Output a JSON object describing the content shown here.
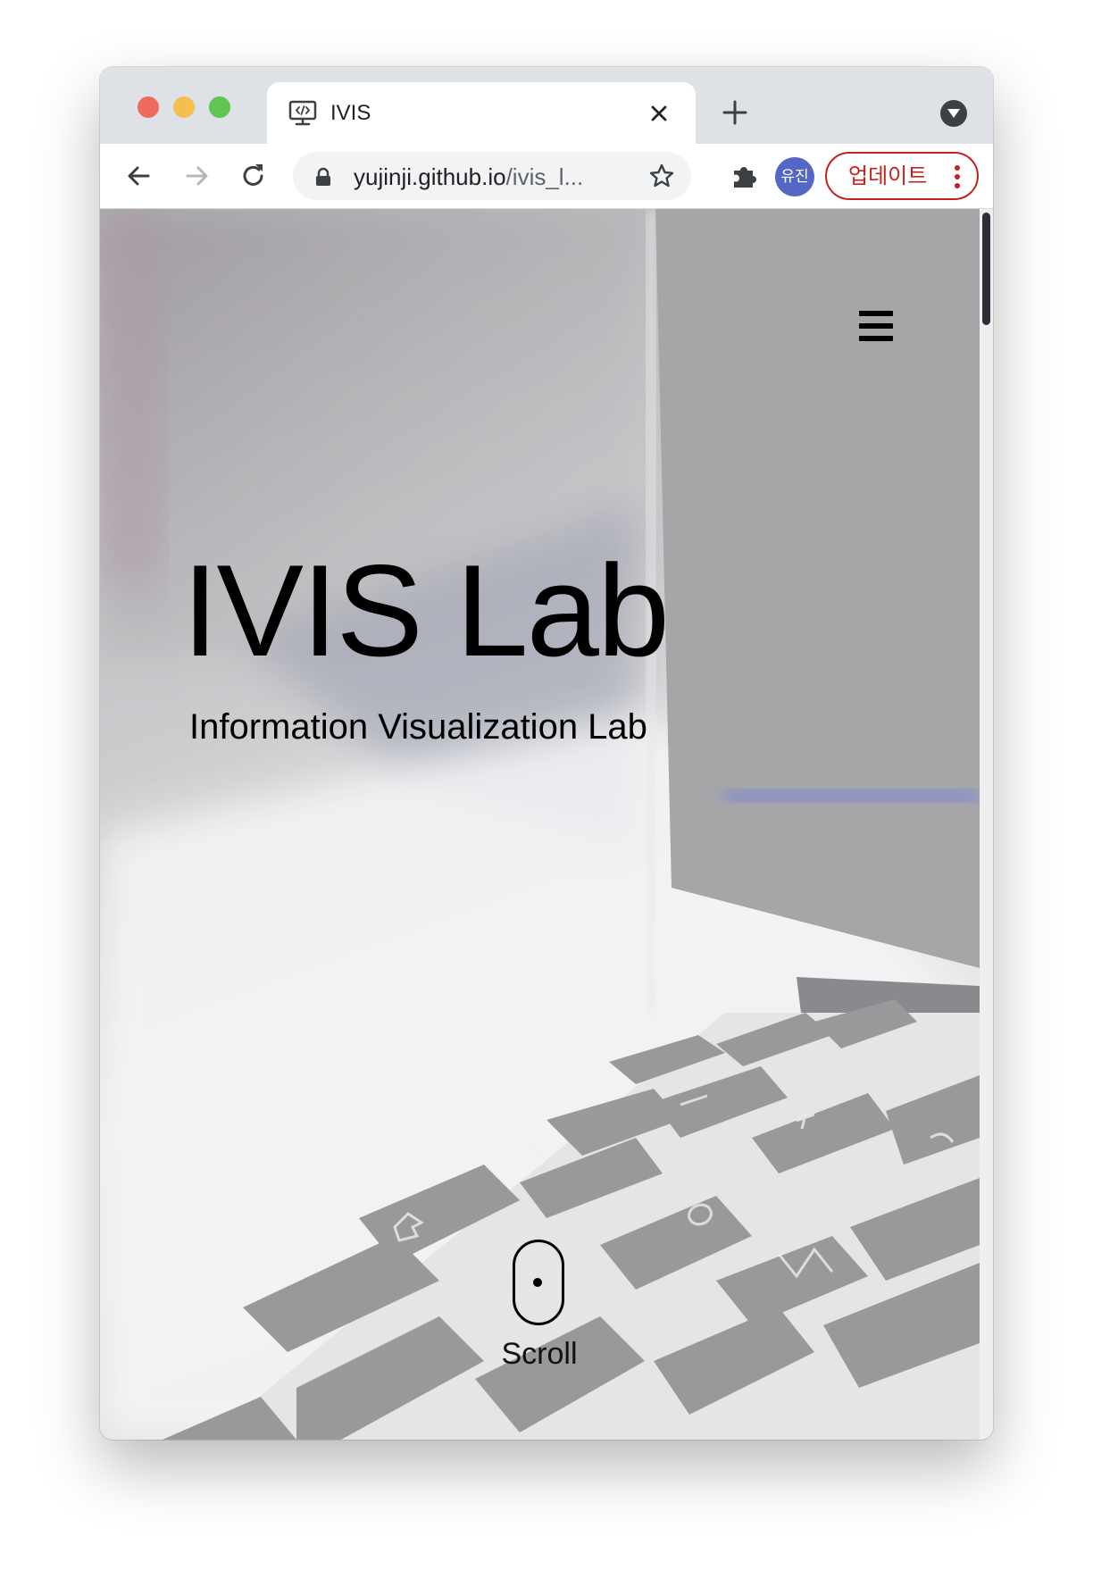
{
  "browser": {
    "tab": {
      "title": "IVIS",
      "favicon": "code-monitor-icon"
    },
    "address_bar": {
      "url_host": "yujinji.github.io",
      "url_path": "/ivis_l..."
    },
    "profile": {
      "initials": "유진",
      "color": "#5467c6"
    },
    "update_button": {
      "label": "업데이트",
      "color": "#c5221f"
    },
    "icons": {
      "back": "back-arrow-icon",
      "forward": "forward-arrow-icon",
      "reload": "reload-icon",
      "lock": "lock-icon",
      "bookmark": "star-icon",
      "extensions": "puzzle-icon",
      "new_tab": "plus-icon",
      "tab_search": "chevron-down-icon",
      "menu": "more-vertical-icon"
    }
  },
  "page": {
    "title": "IVIS Lab",
    "subtitle": "Information Visualization Lab",
    "scroll_label": "Scroll",
    "menu_icon": "hamburger-menu-icon",
    "scroll_indicator_icon": "mouse-icon"
  }
}
